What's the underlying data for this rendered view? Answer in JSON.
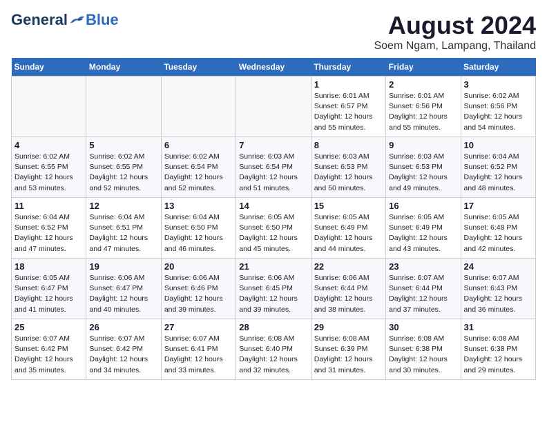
{
  "header": {
    "logo_general": "General",
    "logo_blue": "Blue",
    "month_year": "August 2024",
    "location": "Soem Ngam, Lampang, Thailand"
  },
  "weekdays": [
    "Sunday",
    "Monday",
    "Tuesday",
    "Wednesday",
    "Thursday",
    "Friday",
    "Saturday"
  ],
  "weeks": [
    [
      {
        "day": "",
        "info": ""
      },
      {
        "day": "",
        "info": ""
      },
      {
        "day": "",
        "info": ""
      },
      {
        "day": "",
        "info": ""
      },
      {
        "day": "1",
        "info": "Sunrise: 6:01 AM\nSunset: 6:57 PM\nDaylight: 12 hours\nand 55 minutes."
      },
      {
        "day": "2",
        "info": "Sunrise: 6:01 AM\nSunset: 6:56 PM\nDaylight: 12 hours\nand 55 minutes."
      },
      {
        "day": "3",
        "info": "Sunrise: 6:02 AM\nSunset: 6:56 PM\nDaylight: 12 hours\nand 54 minutes."
      }
    ],
    [
      {
        "day": "4",
        "info": "Sunrise: 6:02 AM\nSunset: 6:55 PM\nDaylight: 12 hours\nand 53 minutes."
      },
      {
        "day": "5",
        "info": "Sunrise: 6:02 AM\nSunset: 6:55 PM\nDaylight: 12 hours\nand 52 minutes."
      },
      {
        "day": "6",
        "info": "Sunrise: 6:02 AM\nSunset: 6:54 PM\nDaylight: 12 hours\nand 52 minutes."
      },
      {
        "day": "7",
        "info": "Sunrise: 6:03 AM\nSunset: 6:54 PM\nDaylight: 12 hours\nand 51 minutes."
      },
      {
        "day": "8",
        "info": "Sunrise: 6:03 AM\nSunset: 6:53 PM\nDaylight: 12 hours\nand 50 minutes."
      },
      {
        "day": "9",
        "info": "Sunrise: 6:03 AM\nSunset: 6:53 PM\nDaylight: 12 hours\nand 49 minutes."
      },
      {
        "day": "10",
        "info": "Sunrise: 6:04 AM\nSunset: 6:52 PM\nDaylight: 12 hours\nand 48 minutes."
      }
    ],
    [
      {
        "day": "11",
        "info": "Sunrise: 6:04 AM\nSunset: 6:52 PM\nDaylight: 12 hours\nand 47 minutes."
      },
      {
        "day": "12",
        "info": "Sunrise: 6:04 AM\nSunset: 6:51 PM\nDaylight: 12 hours\nand 47 minutes."
      },
      {
        "day": "13",
        "info": "Sunrise: 6:04 AM\nSunset: 6:50 PM\nDaylight: 12 hours\nand 46 minutes."
      },
      {
        "day": "14",
        "info": "Sunrise: 6:05 AM\nSunset: 6:50 PM\nDaylight: 12 hours\nand 45 minutes."
      },
      {
        "day": "15",
        "info": "Sunrise: 6:05 AM\nSunset: 6:49 PM\nDaylight: 12 hours\nand 44 minutes."
      },
      {
        "day": "16",
        "info": "Sunrise: 6:05 AM\nSunset: 6:49 PM\nDaylight: 12 hours\nand 43 minutes."
      },
      {
        "day": "17",
        "info": "Sunrise: 6:05 AM\nSunset: 6:48 PM\nDaylight: 12 hours\nand 42 minutes."
      }
    ],
    [
      {
        "day": "18",
        "info": "Sunrise: 6:05 AM\nSunset: 6:47 PM\nDaylight: 12 hours\nand 41 minutes."
      },
      {
        "day": "19",
        "info": "Sunrise: 6:06 AM\nSunset: 6:47 PM\nDaylight: 12 hours\nand 40 minutes."
      },
      {
        "day": "20",
        "info": "Sunrise: 6:06 AM\nSunset: 6:46 PM\nDaylight: 12 hours\nand 39 minutes."
      },
      {
        "day": "21",
        "info": "Sunrise: 6:06 AM\nSunset: 6:45 PM\nDaylight: 12 hours\nand 39 minutes."
      },
      {
        "day": "22",
        "info": "Sunrise: 6:06 AM\nSunset: 6:44 PM\nDaylight: 12 hours\nand 38 minutes."
      },
      {
        "day": "23",
        "info": "Sunrise: 6:07 AM\nSunset: 6:44 PM\nDaylight: 12 hours\nand 37 minutes."
      },
      {
        "day": "24",
        "info": "Sunrise: 6:07 AM\nSunset: 6:43 PM\nDaylight: 12 hours\nand 36 minutes."
      }
    ],
    [
      {
        "day": "25",
        "info": "Sunrise: 6:07 AM\nSunset: 6:42 PM\nDaylight: 12 hours\nand 35 minutes."
      },
      {
        "day": "26",
        "info": "Sunrise: 6:07 AM\nSunset: 6:42 PM\nDaylight: 12 hours\nand 34 minutes."
      },
      {
        "day": "27",
        "info": "Sunrise: 6:07 AM\nSunset: 6:41 PM\nDaylight: 12 hours\nand 33 minutes."
      },
      {
        "day": "28",
        "info": "Sunrise: 6:08 AM\nSunset: 6:40 PM\nDaylight: 12 hours\nand 32 minutes."
      },
      {
        "day": "29",
        "info": "Sunrise: 6:08 AM\nSunset: 6:39 PM\nDaylight: 12 hours\nand 31 minutes."
      },
      {
        "day": "30",
        "info": "Sunrise: 6:08 AM\nSunset: 6:38 PM\nDaylight: 12 hours\nand 30 minutes."
      },
      {
        "day": "31",
        "info": "Sunrise: 6:08 AM\nSunset: 6:38 PM\nDaylight: 12 hours\nand 29 minutes."
      }
    ]
  ]
}
